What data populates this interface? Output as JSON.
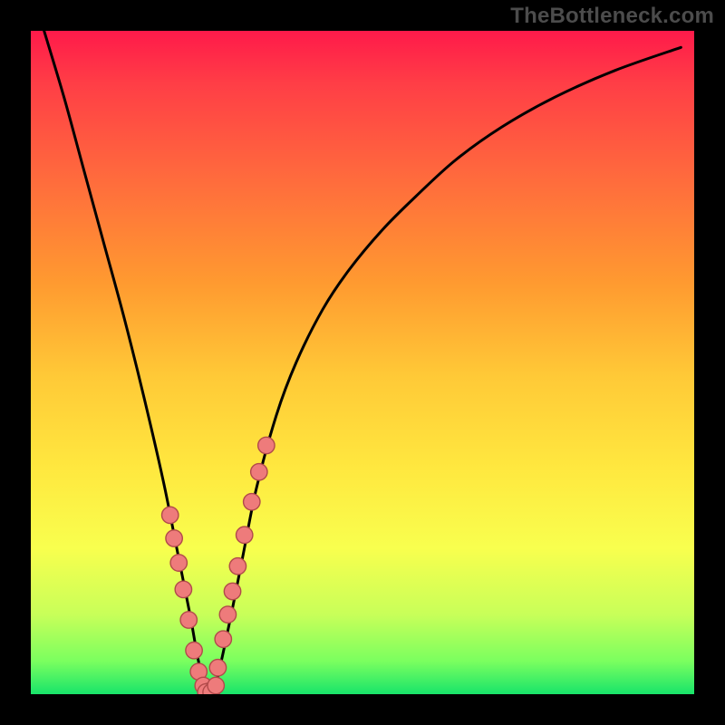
{
  "watermark": "TheBottleneck.com",
  "colors": {
    "background": "#000000",
    "curve_stroke": "#000000",
    "dot_fill": "#ee7b7b",
    "dot_stroke": "#b14a4a",
    "gradient_stops": [
      "#ff1a4a",
      "#ff3e46",
      "#ff6a3d",
      "#ff9a30",
      "#ffc937",
      "#ffe83f",
      "#f8ff4e",
      "#c8ff59",
      "#7bff5f",
      "#18e46a"
    ]
  },
  "chart_data": {
    "type": "line",
    "title": "",
    "xlabel": "",
    "ylabel": "",
    "xlim": [
      0,
      100
    ],
    "ylim": [
      0,
      100
    ],
    "grid": false,
    "curve": {
      "name": "bottleneck-curve",
      "x": [
        2.0,
        5,
        8,
        11,
        14,
        17,
        20,
        22,
        24,
        25.5,
        27,
        28,
        30,
        32,
        34,
        37,
        40,
        44,
        48,
        53,
        58,
        64,
        71,
        79,
        88,
        98
      ],
      "y": [
        100,
        90,
        79,
        68,
        57,
        45,
        32,
        22,
        12,
        4,
        0.5,
        2,
        11,
        21,
        31,
        42,
        50,
        58,
        64,
        70,
        75,
        80.5,
        85.5,
        90,
        94,
        97.5
      ]
    },
    "series": [
      {
        "name": "left-arm-dots",
        "marker": "circle",
        "color": "#ee7b7b",
        "x": [
          21.0,
          21.6,
          22.3,
          23.0,
          23.8,
          24.6,
          25.3,
          26.0,
          26.8
        ],
        "y": [
          27.0,
          23.5,
          19.8,
          15.8,
          11.2,
          6.6,
          3.4,
          1.3,
          0.4
        ]
      },
      {
        "name": "right-arm-dots",
        "marker": "circle",
        "color": "#ee7b7b",
        "x": [
          28.2,
          29.0,
          29.7,
          30.4,
          31.2,
          32.2,
          33.3,
          34.4,
          35.5
        ],
        "y": [
          4.0,
          8.3,
          12.0,
          15.5,
          19.3,
          24.0,
          29.0,
          33.5,
          37.5
        ]
      },
      {
        "name": "floor-dots",
        "marker": "circle",
        "color": "#ee7b7b",
        "x": [
          26.4,
          27.2,
          27.9
        ],
        "y": [
          0.3,
          0.3,
          1.3
        ]
      }
    ]
  }
}
